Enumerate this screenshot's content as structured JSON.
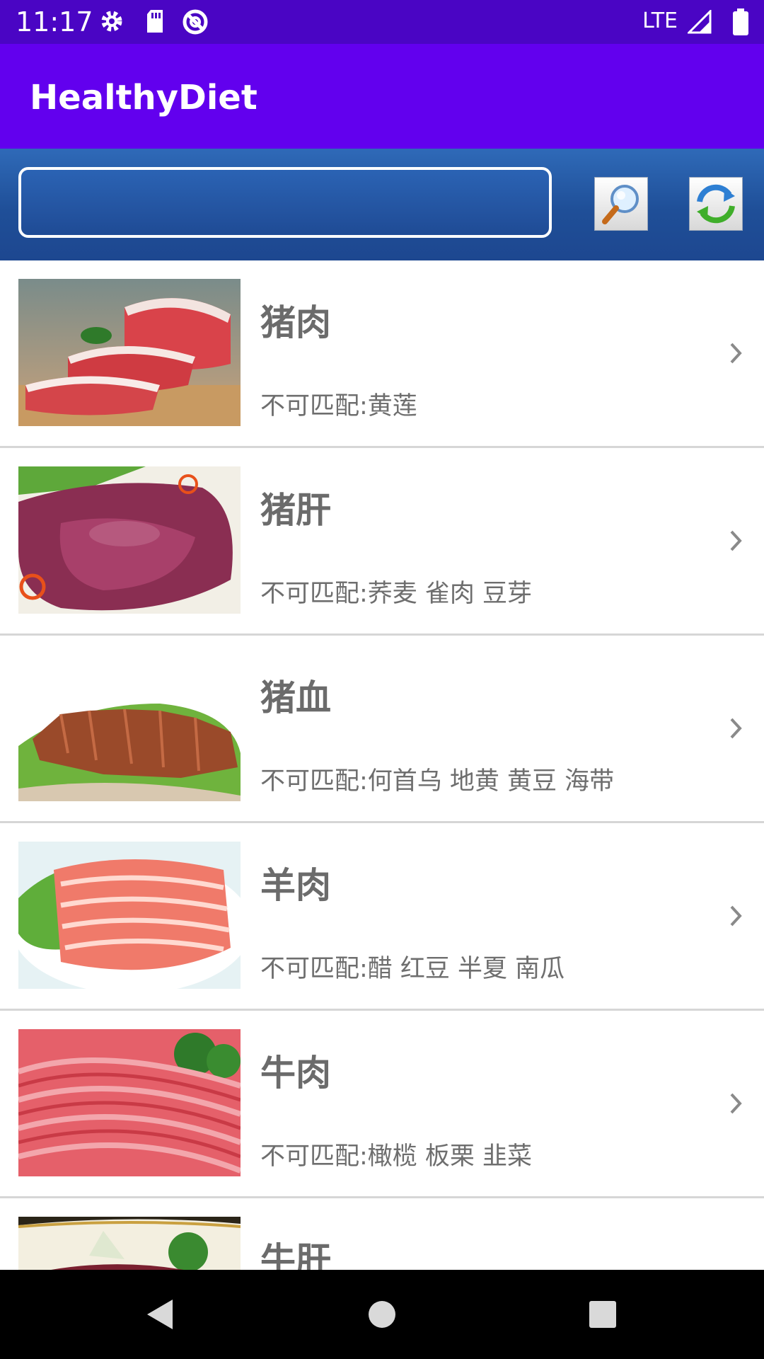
{
  "status_bar": {
    "time": "11:17",
    "network": "LTE",
    "icons": [
      "gear-icon",
      "sd-card-icon",
      "no-sync-icon",
      "signal-icon",
      "battery-icon"
    ]
  },
  "app_bar": {
    "title": "HealthyDiet"
  },
  "search": {
    "value": "",
    "placeholder": "",
    "search_icon": "magnifier-icon",
    "refresh_icon": "refresh-icon"
  },
  "foods": [
    {
      "name": "猪肉",
      "conflict": "不可匹配:黄莲"
    },
    {
      "name": "猪肝",
      "conflict": "不可匹配:荞麦 雀肉 豆芽"
    },
    {
      "name": "猪血",
      "conflict": "不可匹配:何首乌 地黄 黄豆 海带"
    },
    {
      "name": "羊肉",
      "conflict": "不可匹配:醋 红豆 半夏 南瓜"
    },
    {
      "name": "牛肉",
      "conflict": "不可匹配:橄榄 板栗 韭菜"
    },
    {
      "name": "牛肝",
      "conflict": ""
    }
  ],
  "nav_bar": {
    "icons": [
      "back-icon",
      "home-icon",
      "recents-icon"
    ]
  },
  "colors": {
    "status_bar": "#4a05c4",
    "app_bar": "#6200ee",
    "search_bar": "#1f4f98"
  }
}
